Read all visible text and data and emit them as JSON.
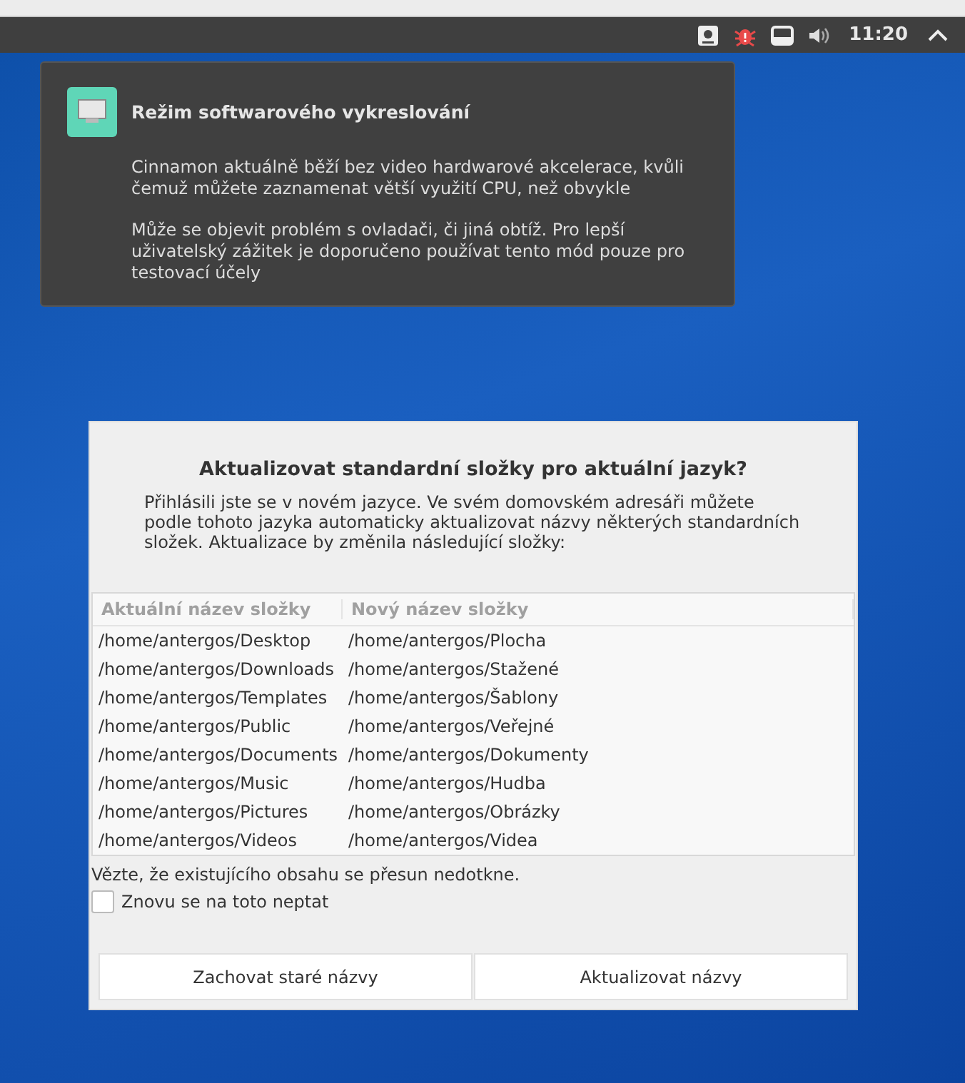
{
  "panel": {
    "clock": "11:20"
  },
  "notification": {
    "title": "Režim softwarového vykreslování",
    "paragraphs": [
      "Cinnamon aktuálně běží bez video hardwarové akcelerace, kvůli čemuž můžete zaznamenat větší využití CPU, než obvykle",
      "Může se objevit problém s ovladači, či jiná obtíž. Pro lepší uživatelský zážitek je doporučeno používat tento mód pouze pro testovací účely"
    ]
  },
  "dialog": {
    "title": "Aktualizovat standardní složky pro aktuální jazyk?",
    "description": "Přihlásili jste se v novém jazyce. Ve svém domovském adresáři můžete podle tohoto jazyka automaticky aktualizovat názvy některých standardních složek. Aktualizace by změnila následující složky:",
    "table": {
      "columns": [
        "Aktuální název složky",
        "Nový název složky"
      ],
      "rows": [
        [
          "/home/antergos/Desktop",
          "/home/antergos/Plocha"
        ],
        [
          "/home/antergos/Downloads",
          "/home/antergos/Stažené"
        ],
        [
          "/home/antergos/Templates",
          "/home/antergos/Šablony"
        ],
        [
          "/home/antergos/Public",
          "/home/antergos/Veřejné"
        ],
        [
          "/home/antergos/Documents",
          "/home/antergos/Dokumenty"
        ],
        [
          "/home/antergos/Music",
          "/home/antergos/Hudba"
        ],
        [
          "/home/antergos/Pictures",
          "/home/antergos/Obrázky"
        ],
        [
          "/home/antergos/Videos",
          "/home/antergos/Videa"
        ]
      ]
    },
    "note": "Vězte, že existujícího obsahu se přesun nedotkne.",
    "checkbox": {
      "label": "Znovu se na toto neptat",
      "checked": false
    },
    "buttons": [
      "Zachovat staré názvy",
      "Aktualizovat názvy"
    ]
  }
}
